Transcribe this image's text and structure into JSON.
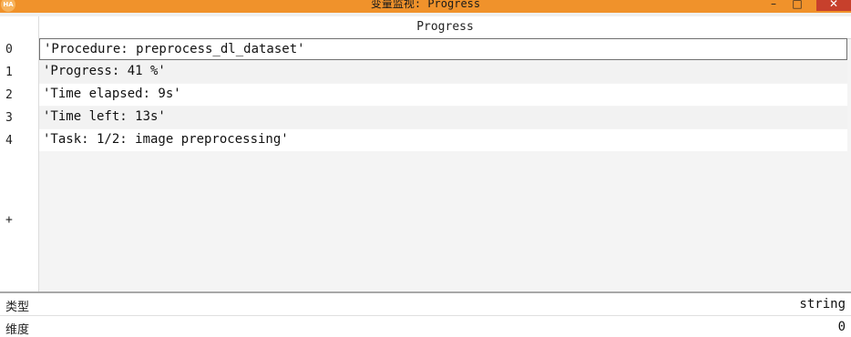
{
  "window": {
    "title": "变量监视: Progress",
    "icon_name": "halcon-app-icon",
    "title_bar_color": "#f0922b",
    "minimize_glyph": "–",
    "maximize_glyph": "□",
    "close_glyph": "✕"
  },
  "list": {
    "column_header": "Progress",
    "indices": [
      "0",
      "1",
      "2",
      "3",
      "4"
    ],
    "rows": [
      "'Procedure: preprocess_dl_dataset'",
      "'Progress: 41 %'",
      "'Time elapsed: 9s'",
      "'Time left: 13s'",
      "'Task: 1/2: image preprocessing'"
    ],
    "add_row_label": "+"
  },
  "info": {
    "type_label": "类型",
    "type_value": "string",
    "dimension_label": "维度",
    "dimension_value": "0"
  }
}
